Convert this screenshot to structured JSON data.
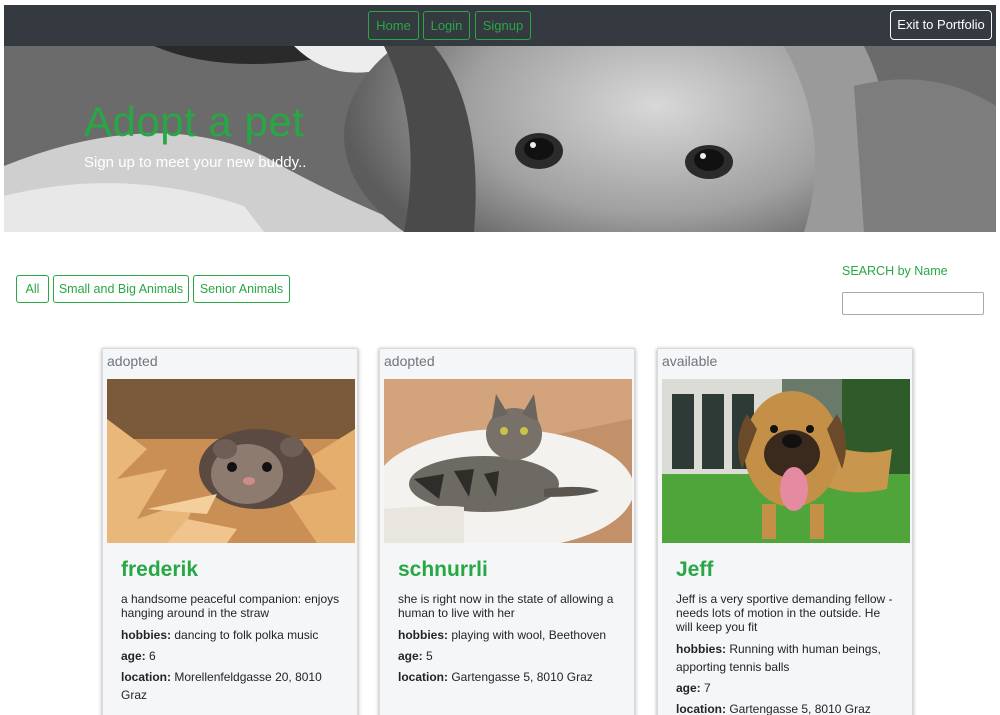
{
  "nav": {
    "home": "Home",
    "login": "Login",
    "signup": "Signup",
    "exit": "Exit to Portfolio"
  },
  "hero": {
    "title": "Adopt a pet",
    "subtitle": "Sign up to meet your new buddy.."
  },
  "filters": [
    "All",
    "Small and Big Animals",
    "Senior Animals"
  ],
  "search": {
    "label": "SEARCH by Name",
    "value": ""
  },
  "labels": {
    "hobbies": "hobbies:",
    "age": "age:",
    "location": "location:"
  },
  "pets": [
    {
      "status": "adopted",
      "name": "frederik",
      "description": "a handsome peaceful companion: enjoys hanging around in the straw",
      "hobbies": "dancing to folk polka music",
      "age": "6",
      "location": "Morellenfeldgasse 20, 8010 Graz"
    },
    {
      "status": "adopted",
      "name": "schnurrli",
      "description": "she is right now in the state of allowing a human to live with her",
      "hobbies": "playing with wool, Beethoven",
      "age": "5",
      "location": "Gartengasse 5, 8010 Graz"
    },
    {
      "status": "available",
      "name": "Jeff",
      "description": "Jeff is a very sportive demanding fellow - needs lots of motion in the outside. He will keep you fit",
      "hobbies": "Running with human beings, apporting tennis balls",
      "age": "7",
      "location": "Gartengasse 5, 8010 Graz"
    }
  ],
  "colors": {
    "accent": "#28a745",
    "navbar": "#343a40",
    "card_bg": "#f5f6f8"
  }
}
